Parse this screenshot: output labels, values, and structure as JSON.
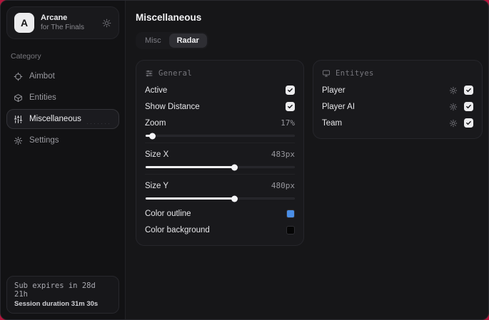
{
  "sidebar": {
    "brand": {
      "logo_letter": "A",
      "title": "Arcane",
      "subtitle": "for The Finals"
    },
    "category_label": "Category",
    "items": [
      {
        "label": "Aimbot",
        "selected": false
      },
      {
        "label": "Entities",
        "selected": false
      },
      {
        "label": "Miscellaneous",
        "selected": true
      },
      {
        "label": "Settings",
        "selected": false
      }
    ],
    "footer": {
      "line1": "Sub expires in 28d 21h",
      "line2": "Session duration 31m 30s"
    }
  },
  "main": {
    "title": "Miscellaneous",
    "tabs": [
      {
        "label": "Misc",
        "selected": false
      },
      {
        "label": "Radar",
        "selected": true
      }
    ],
    "general_card": {
      "title": "General",
      "toggles": [
        {
          "label": "Active",
          "checked": true
        },
        {
          "label": "Show Distance",
          "checked": true
        }
      ],
      "sliders": [
        {
          "label": "Zoom",
          "value": "17%",
          "fill_percent": 5
        },
        {
          "label": "Size X",
          "value": "483px",
          "fill_percent": 60
        },
        {
          "label": "Size Y",
          "value": "480px",
          "fill_percent": 60
        }
      ],
      "colors": [
        {
          "label": "Color outline",
          "color": "#4a8ee6"
        },
        {
          "label": "Color background",
          "color": "#050505"
        }
      ]
    },
    "entities_card": {
      "title": "Entityes",
      "rows": [
        {
          "label": "Player",
          "checked": true
        },
        {
          "label": "Player AI",
          "checked": true
        },
        {
          "label": "Team",
          "checked": true
        }
      ]
    }
  }
}
